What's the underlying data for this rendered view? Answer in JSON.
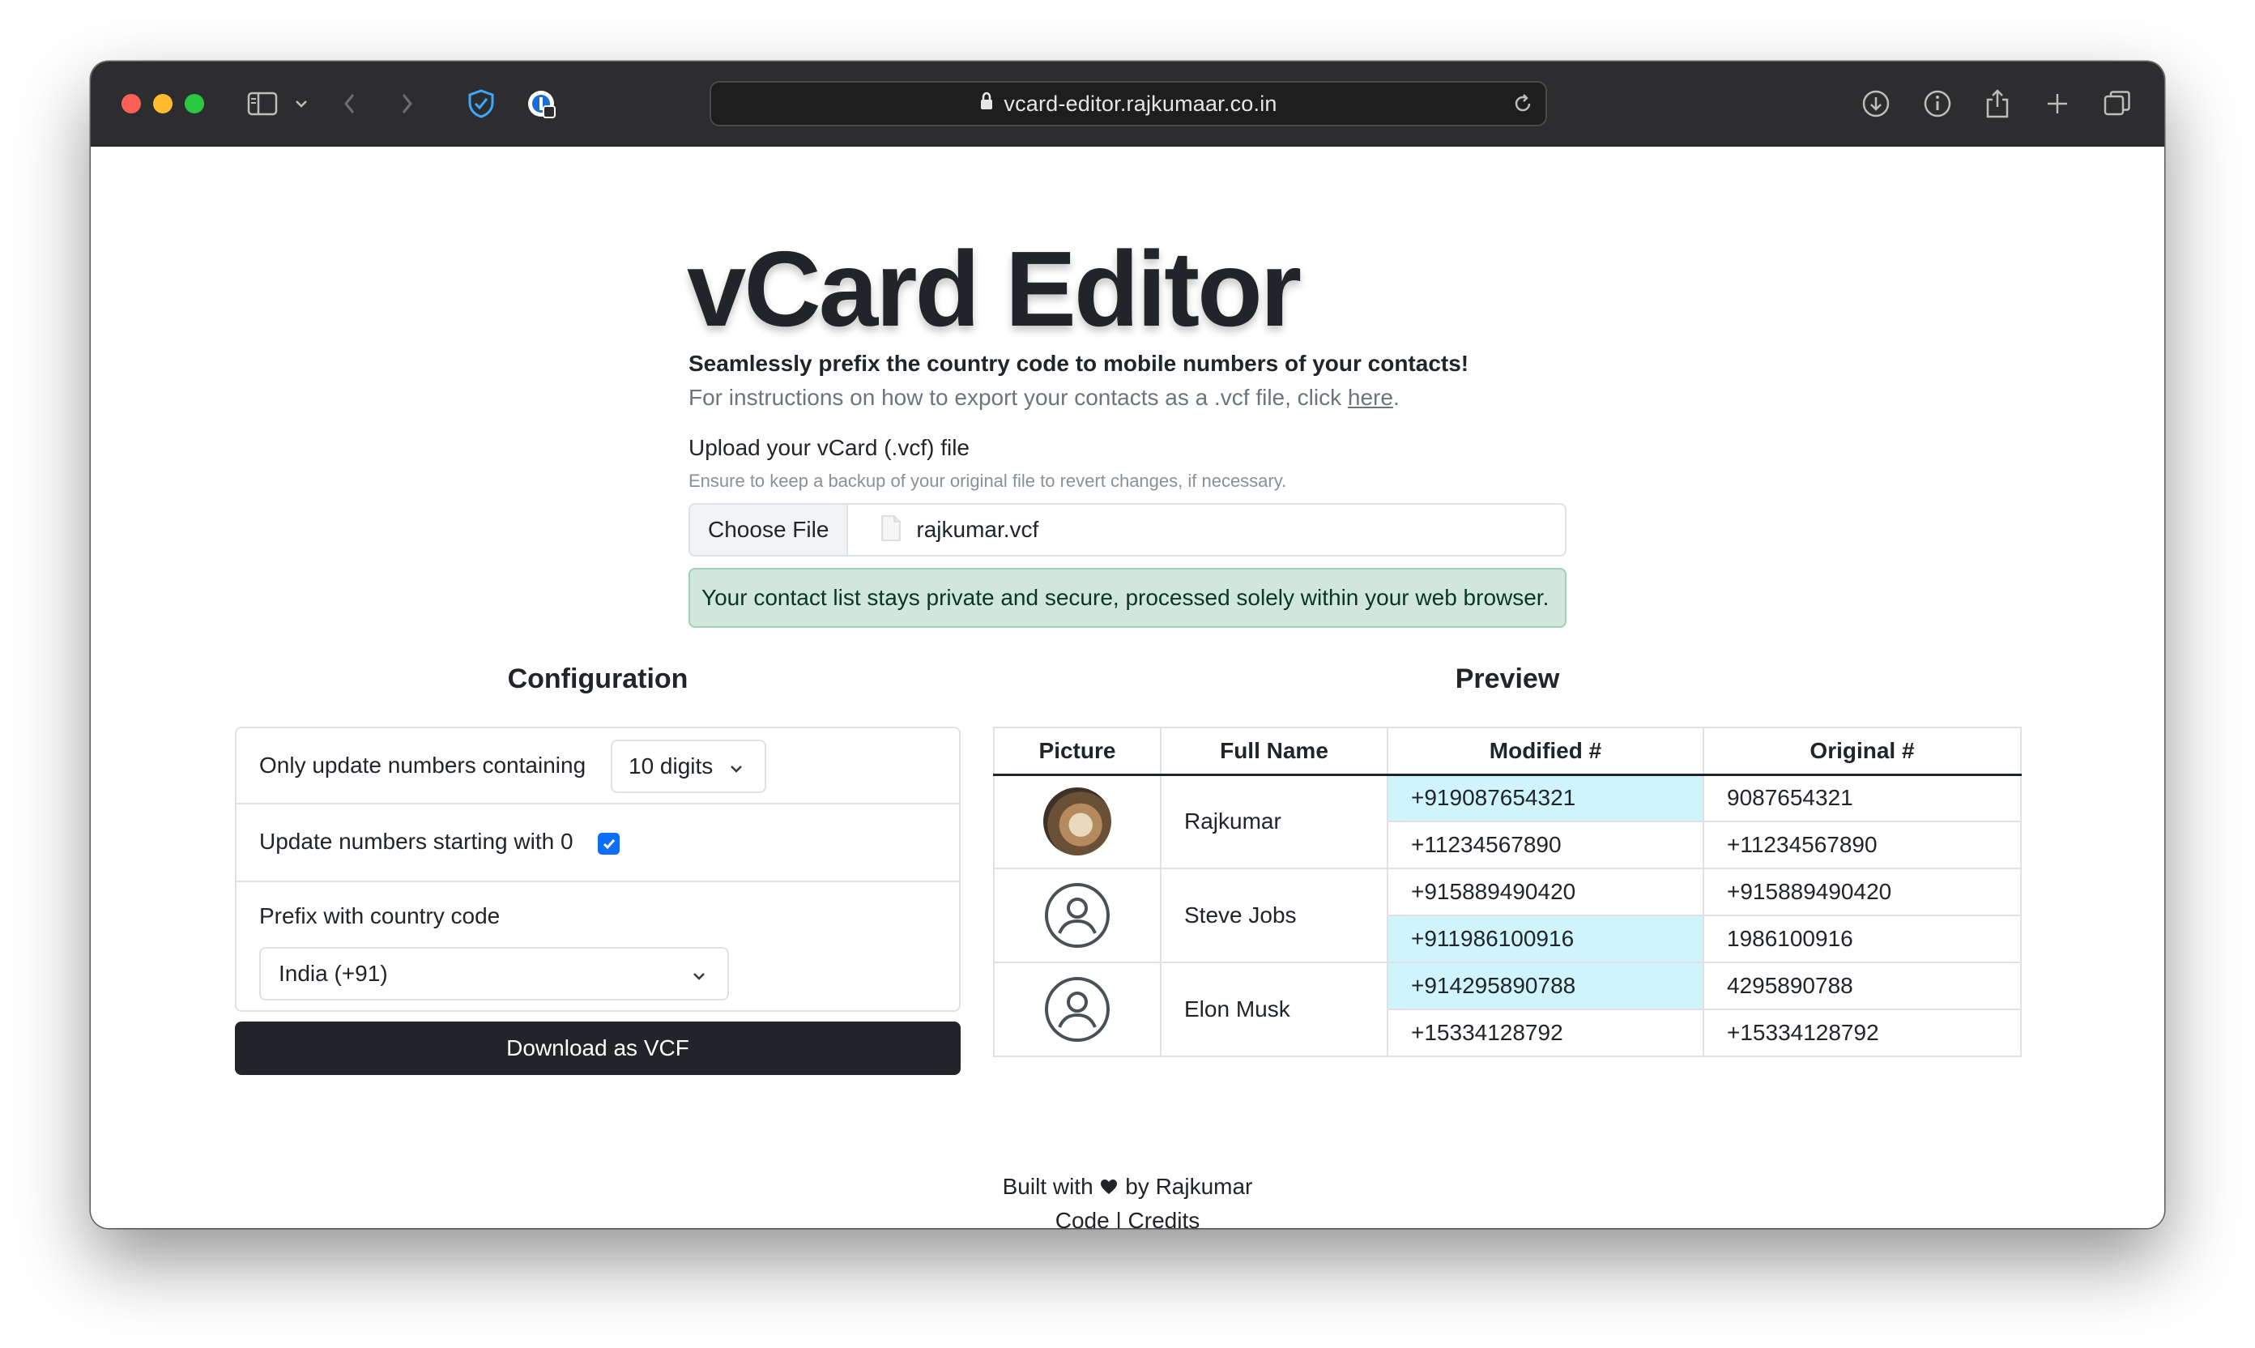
{
  "browser": {
    "url": "vcard-editor.rajkumaar.co.in"
  },
  "page": {
    "title": "vCard Editor",
    "lead": "Seamlessly prefix the country code to mobile numbers of your contacts!",
    "instructions_prefix": "For instructions on how to export your contacts as a .vcf file, click ",
    "instructions_link": "here",
    "instructions_suffix": ".",
    "upload_label": "Upload your vCard (.vcf) file",
    "upload_hint": "Ensure to keep a backup of your original file to revert changes, if necessary.",
    "choose_file_label": "Choose File",
    "file_name": "rajkumar.vcf",
    "privacy_alert": "Your contact list stays private and secure, processed solely within your web browser."
  },
  "configuration": {
    "title": "Configuration",
    "digits_label": "Only update numbers containing",
    "digits_value": "10 digits",
    "starting_zero_label": "Update numbers starting with 0",
    "starting_zero_checked": true,
    "prefix_label": "Prefix with country code",
    "country_value": "India (+91)",
    "download_label": "Download as VCF"
  },
  "preview": {
    "title": "Preview",
    "columns": [
      "Picture",
      "Full Name",
      "Modified #",
      "Original #"
    ],
    "contacts": [
      {
        "name": "Rajkumar",
        "picture": "photo",
        "numbers": [
          {
            "modified": "+919087654321",
            "original": "9087654321",
            "changed": true
          },
          {
            "modified": "+11234567890",
            "original": "+11234567890",
            "changed": false
          }
        ]
      },
      {
        "name": "Steve Jobs",
        "picture": "person-icon",
        "numbers": [
          {
            "modified": "+915889490420",
            "original": "+915889490420",
            "changed": false
          },
          {
            "modified": "+911986100916",
            "original": "1986100916",
            "changed": true
          }
        ]
      },
      {
        "name": "Elon Musk",
        "picture": "person-icon",
        "numbers": [
          {
            "modified": "+914295890788",
            "original": "4295890788",
            "changed": true
          },
          {
            "modified": "+15334128792",
            "original": "+15334128792",
            "changed": false
          }
        ]
      }
    ]
  },
  "footer": {
    "built_prefix": "Built with",
    "built_suffix": "by Rajkumar",
    "code_link": "Code",
    "separator": "|",
    "credits_link": "Credits"
  },
  "colors": {
    "highlight": "#cff4fc",
    "alert_bg": "#d1e7dd",
    "checkbox": "#0d6efd",
    "button_dark": "#212529"
  }
}
